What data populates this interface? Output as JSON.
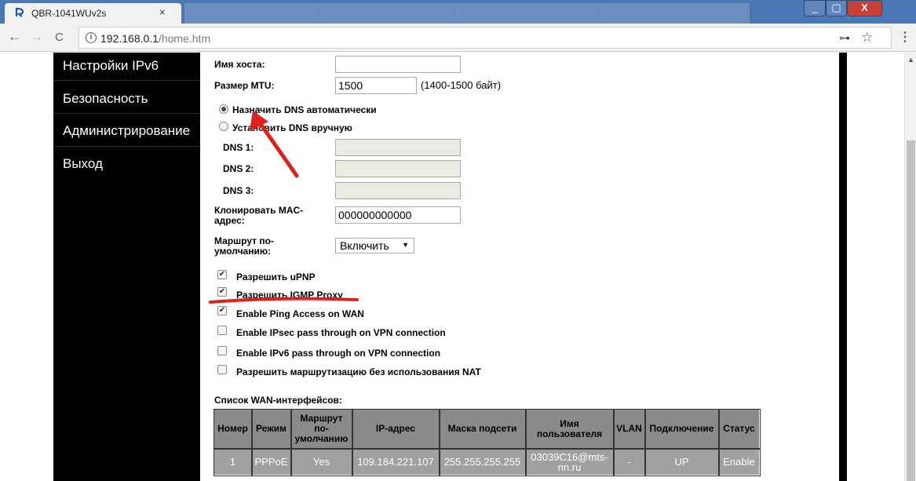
{
  "browser": {
    "tab_title": "QBR-1041WUv2s",
    "tab_close": "×",
    "url_host": "192.168.0.1",
    "url_path": "/home.htm",
    "back": "←",
    "forward": "→",
    "reload": "C",
    "key_icon": "🔑",
    "star": "☆",
    "menu": "⋮",
    "min": "_",
    "max": "▢",
    "close": "X"
  },
  "sidebar": {
    "items": [
      {
        "label": "Настройки IPv6"
      },
      {
        "label": "Безопасность"
      },
      {
        "label": "Администрирование"
      },
      {
        "label": "Выход"
      }
    ]
  },
  "form": {
    "hostname_label": "Имя хоста:",
    "hostname_value": "",
    "mtu_label": "Размер MTU:",
    "mtu_value": "1500",
    "mtu_hint": "(1400-1500 байт)",
    "dns_auto_label": "Назначить DNS автоматически",
    "dns_manual_label": "Установить DNS вручную",
    "dns1_label": "DNS 1:",
    "dns2_label": "DNS 2:",
    "dns3_label": "DNS 3:",
    "mac_label_1": "Клонировать MAC-",
    "mac_label_2": "адрес:",
    "mac_value": "000000000000",
    "route_label_1": "Маршрут по-",
    "route_label_2": "умолчанию:",
    "route_value": "Включить",
    "checkboxes": [
      {
        "label": "Разрешить uPNP",
        "checked": true
      },
      {
        "label": "Разрешить IGMP Proxy",
        "checked": true
      },
      {
        "label": "Enable Ping Access on WAN",
        "checked": true
      },
      {
        "label": "Enable IPsec pass through on VPN connection",
        "checked": false
      },
      {
        "label": "Enable IPv6 pass through on VPN connection",
        "checked": false
      },
      {
        "label": "Разрешить маршрутизацию без использования NAT",
        "checked": false
      }
    ]
  },
  "wan": {
    "title": "Список WAN-интерфейсов:",
    "headers": [
      "Номер",
      "Режим",
      "Маршрут по- умолчанию",
      "IP-адрес",
      "Маска подсети",
      "Имя пользователя",
      "VLAN",
      "Подключение",
      "Статус"
    ],
    "rows": [
      [
        "1",
        "PPPoE",
        "Yes",
        "109.184.221.107",
        "255.255.255.255",
        "03039C16@mts-nn.ru",
        "-",
        "UP",
        "Enable"
      ]
    ]
  },
  "colors": {
    "annotation": "#e0201b",
    "sidebar_bg": "#000000",
    "table_header": "#8a8a8a",
    "table_cell": "#a0a0a0"
  }
}
